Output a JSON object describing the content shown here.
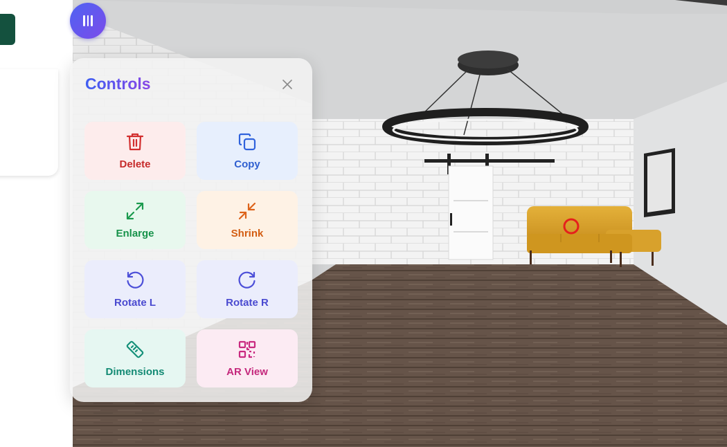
{
  "controls": {
    "title": "Controls",
    "buttons": {
      "delete": "Delete",
      "copy": "Copy",
      "enlarge": "Enlarge",
      "shrink": "Shrink",
      "rotate_left": "Rotate L",
      "rotate_right": "Rotate R",
      "dimensions": "Dimensions",
      "ar_view": "AR View"
    }
  },
  "icons": {
    "menu": "menu-icon",
    "close": "close-icon",
    "delete": "trash-icon",
    "copy": "copy-icon",
    "enlarge": "expand-icon",
    "shrink": "shrink-icon",
    "rotate_left": "rotate-left-icon",
    "rotate_right": "rotate-right-icon",
    "dimensions": "ruler-icon",
    "ar_view": "qr-code-icon"
  },
  "colors": {
    "accent_start": "#4f63f2",
    "accent_end": "#7b4bea",
    "sidebar_button": "#14513e",
    "selection_marker": "#e5201c"
  }
}
